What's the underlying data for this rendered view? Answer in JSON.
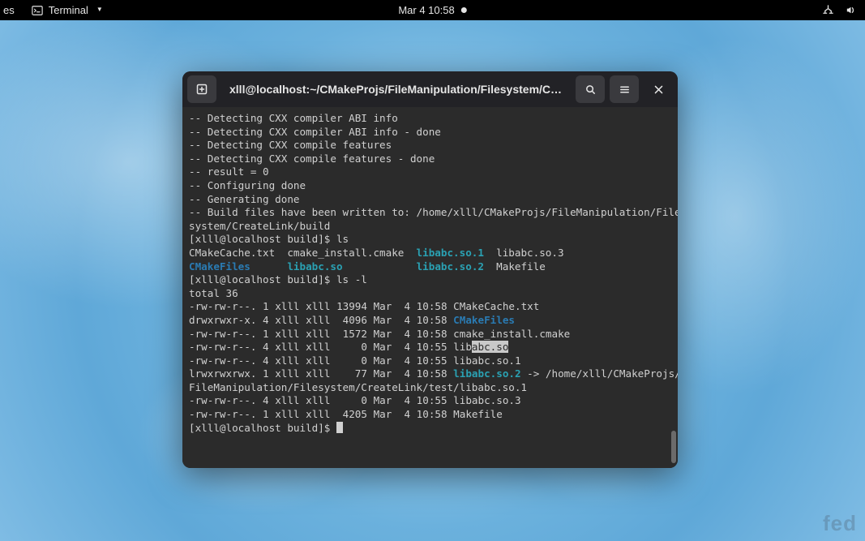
{
  "topbar": {
    "left_truncated": "es",
    "app_name": "Terminal",
    "clock": "Mar 4  10:58"
  },
  "brand": "fed",
  "terminal": {
    "title": "xlll@localhost:~/CMakeProjs/FileManipulation/Filesystem/Creat…",
    "lines": [
      {
        "t": "-- Detecting CXX compiler ABI info"
      },
      {
        "t": "-- Detecting CXX compiler ABI info - done"
      },
      {
        "t": "-- Detecting CXX compile features"
      },
      {
        "t": "-- Detecting CXX compile features - done"
      },
      {
        "t": "-- result = 0"
      },
      {
        "t": "-- Configuring done"
      },
      {
        "t": "-- Generating done"
      },
      {
        "t": "-- Build files have been written to: /home/xlll/CMakeProjs/FileManipulation/File"
      },
      {
        "t": "system/CreateLink/build"
      }
    ],
    "ls_prompt": "[xlll@localhost build]$ ls",
    "ls_row1": {
      "a": "CMakeCache.txt  cmake_install.cmake  ",
      "b": "libabc.so.1",
      "c": "  libabc.so.3"
    },
    "ls_row2": {
      "a": "CMakeFiles",
      "b": "      ",
      "c": "libabc.so",
      "d": "            ",
      "e": "libabc.so.2",
      "f": "  Makefile"
    },
    "lsl_prompt": "[xlll@localhost build]$ ls -l",
    "total_line": "total 36",
    "entries": [
      {
        "perm": "-rw-rw-r--.",
        "ln": "1",
        "u": "xlll",
        "g": "xlll",
        "size": "13994",
        "date": "Mar  4 10:58",
        "name": "CMakeCache.txt",
        "style": "",
        "pre": "",
        "suf": ""
      },
      {
        "perm": "drwxrwxr-x.",
        "ln": "4",
        "u": "xlll",
        "g": "xlll",
        "size": " 4096",
        "date": "Mar  4 10:58",
        "name": "CMakeFiles",
        "style": "blue",
        "pre": "",
        "suf": ""
      },
      {
        "perm": "-rw-rw-r--.",
        "ln": "1",
        "u": "xlll",
        "g": "xlll",
        "size": " 1572",
        "date": "Mar  4 10:58",
        "name": "cmake_install.cmake",
        "style": "",
        "pre": "",
        "suf": ""
      },
      {
        "perm": "-rw-rw-r--.",
        "ln": "4",
        "u": "xlll",
        "g": "xlll",
        "size": "    0",
        "date": "Mar  4 10:55",
        "pre_name": "lib",
        "hl_name": "abc.so",
        "name": "",
        "style": "hl-composite",
        "suf": ""
      },
      {
        "perm": "-rw-rw-r--.",
        "ln": "4",
        "u": "xlll",
        "g": "xlll",
        "size": "    0",
        "date": "Mar  4 10:55",
        "name": "libabc.so.1",
        "style": "",
        "pre": "",
        "suf": ""
      }
    ],
    "symlink": {
      "perm": "lrwxrwxrwx.",
      "ln": "1",
      "u": "xlll",
      "g": "xlll",
      "size": "   77",
      "date": "Mar  4 10:58",
      "name": "libabc.so.2",
      "arrow": " -> ",
      "target1": "/home/xlll/CMakeProjs/",
      "target2": "FileManipulation/Filesystem/CreateLink/test/libabc.so.1"
    },
    "entries2": [
      {
        "perm": "-rw-rw-r--.",
        "ln": "4",
        "u": "xlll",
        "g": "xlll",
        "size": "    0",
        "date": "Mar  4 10:55",
        "name": "libabc.so.3"
      },
      {
        "perm": "-rw-rw-r--.",
        "ln": "1",
        "u": "xlll",
        "g": "xlll",
        "size": " 4205",
        "date": "Mar  4 10:58",
        "name": "Makefile"
      }
    ],
    "last_prompt": "[xlll@localhost build]$ "
  }
}
